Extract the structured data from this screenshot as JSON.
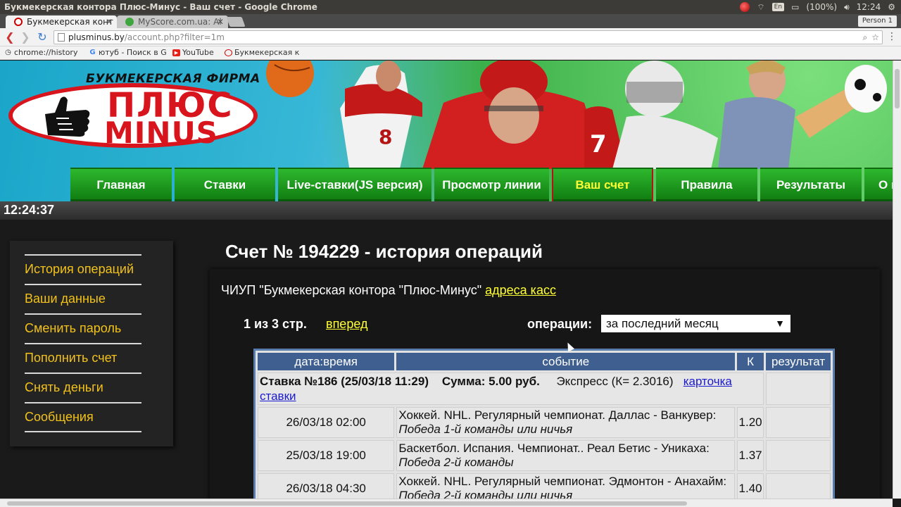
{
  "os": {
    "window_title": "Букмекерская контора Плюс-Минус - Ваш счет - Google Chrome",
    "lang": "En",
    "battery": "(100%)",
    "time": "12:24"
  },
  "browser": {
    "tabs": [
      {
        "label": "Букмекерская конт",
        "active": true
      },
      {
        "label": "MyScore.com.ua: Al",
        "active": false
      }
    ],
    "profile": "Person 1",
    "url_host": "plusminus.by",
    "url_path": "/account.php?filter=1m",
    "bookmarks": [
      {
        "label": "chrome://history",
        "icon": "history-icon"
      },
      {
        "label": "ютуб - Поиск в G",
        "icon": "google-icon"
      },
      {
        "label": "YouTube",
        "icon": "youtube-icon"
      },
      {
        "label": "Букмекерская к",
        "icon": "site-icon"
      }
    ]
  },
  "site": {
    "logo_top": "БУКМЕКЕРСКАЯ ФИРМА",
    "logo_plus": "ПЛЮС",
    "logo_minus": "MINUS",
    "nav": [
      {
        "label": "Главная",
        "active": false
      },
      {
        "label": "Ставки",
        "active": false
      },
      {
        "label": "Live-ставки(JS версия)",
        "active": false
      },
      {
        "label": "Просмотр линии",
        "active": false
      },
      {
        "label": "Ваш счет",
        "active": true
      },
      {
        "label": "Правила",
        "active": false
      },
      {
        "label": "Результаты",
        "active": false
      },
      {
        "label": "О п",
        "active": false
      }
    ],
    "clock": "12:24:37",
    "side_menu": [
      "История операций",
      "Ваши данные",
      "Сменить пароль",
      "Пополнить счет",
      "Снять деньги",
      "Сообщения"
    ],
    "heading": "Счет № 194229 - история операций",
    "org_text": "ЧИУП \"Букмекерская контора \"Плюс-Минус\"",
    "org_link": "адреса касс",
    "pager": "1 из 3 стр.",
    "next_link": "вперед",
    "ops_label": "операции:",
    "ops_selected": "за последний месяц",
    "table": {
      "headers": [
        "дата:время",
        "событие",
        "К",
        "результат"
      ],
      "bet": {
        "title": "Ставка №186 (25/03/18 11:29)",
        "sum": "Сумма: 5.00 руб.",
        "type": "Экспресс (К= 2.3016)",
        "link": "карточка ставки"
      },
      "rows": [
        {
          "datetime": "26/03/18 02:00",
          "event": "Хоккей. NHL. Регулярный чемпионат. Даллас - Ванкувер:",
          "outcome": "Победа 1-й команды или ничья",
          "k": "1.20",
          "result": ""
        },
        {
          "datetime": "25/03/18 19:00",
          "event": "Баскетбол. Испания. Чемпионат.. Реал Бетис - Уникаха:",
          "outcome": "Победа 2-й команды",
          "k": "1.37",
          "result": ""
        },
        {
          "datetime": "26/03/18 04:30",
          "event": "Хоккей. NHL. Регулярный чемпионат. Эдмонтон - Анахайм:",
          "outcome": "Победа 2-й команды или ничья",
          "k": "1.40",
          "result": ""
        }
      ]
    }
  }
}
